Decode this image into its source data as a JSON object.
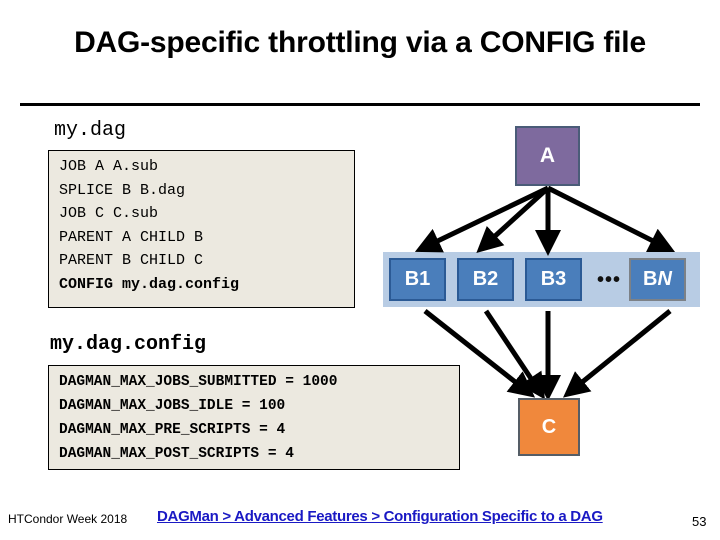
{
  "slide": {
    "title": "DAG-specific throttling via a CONFIG file",
    "page_number": "53"
  },
  "dag_file": {
    "label": "my.dag",
    "lines": [
      "JOB A A.sub",
      "SPLICE B B.dag",
      "JOB C C.sub",
      "PARENT A CHILD B",
      "PARENT B CHILD C",
      "CONFIG my.dag.config"
    ],
    "bold_line_index": 5
  },
  "config_file": {
    "label": "my.dag.config",
    "lines": [
      "DAGMAN_MAX_JOBS_SUBMITTED = 1000",
      "DAGMAN_MAX_JOBS_IDLE = 100",
      "DAGMAN_MAX_PRE_SCRIPTS = 4",
      "DAGMAN_MAX_POST_SCRIPTS = 4"
    ]
  },
  "diagram": {
    "node_a": "A",
    "node_b1": "B1",
    "node_b2": "B2",
    "node_b3": "B3",
    "node_bn_prefix": "B",
    "node_bn_suffix": "N",
    "ellipsis": "•••",
    "node_c": "C",
    "colors": {
      "node_a": "#7e6a9e",
      "node_b": "#4a7ebb",
      "band": "#b8cce4",
      "node_c": "#f0883c",
      "arrow": "#000000"
    }
  },
  "footer": {
    "left": "HTCondor Week 2018",
    "breadcrumb": "DAGMan > Advanced Features > Configuration Specific to a DAG"
  }
}
